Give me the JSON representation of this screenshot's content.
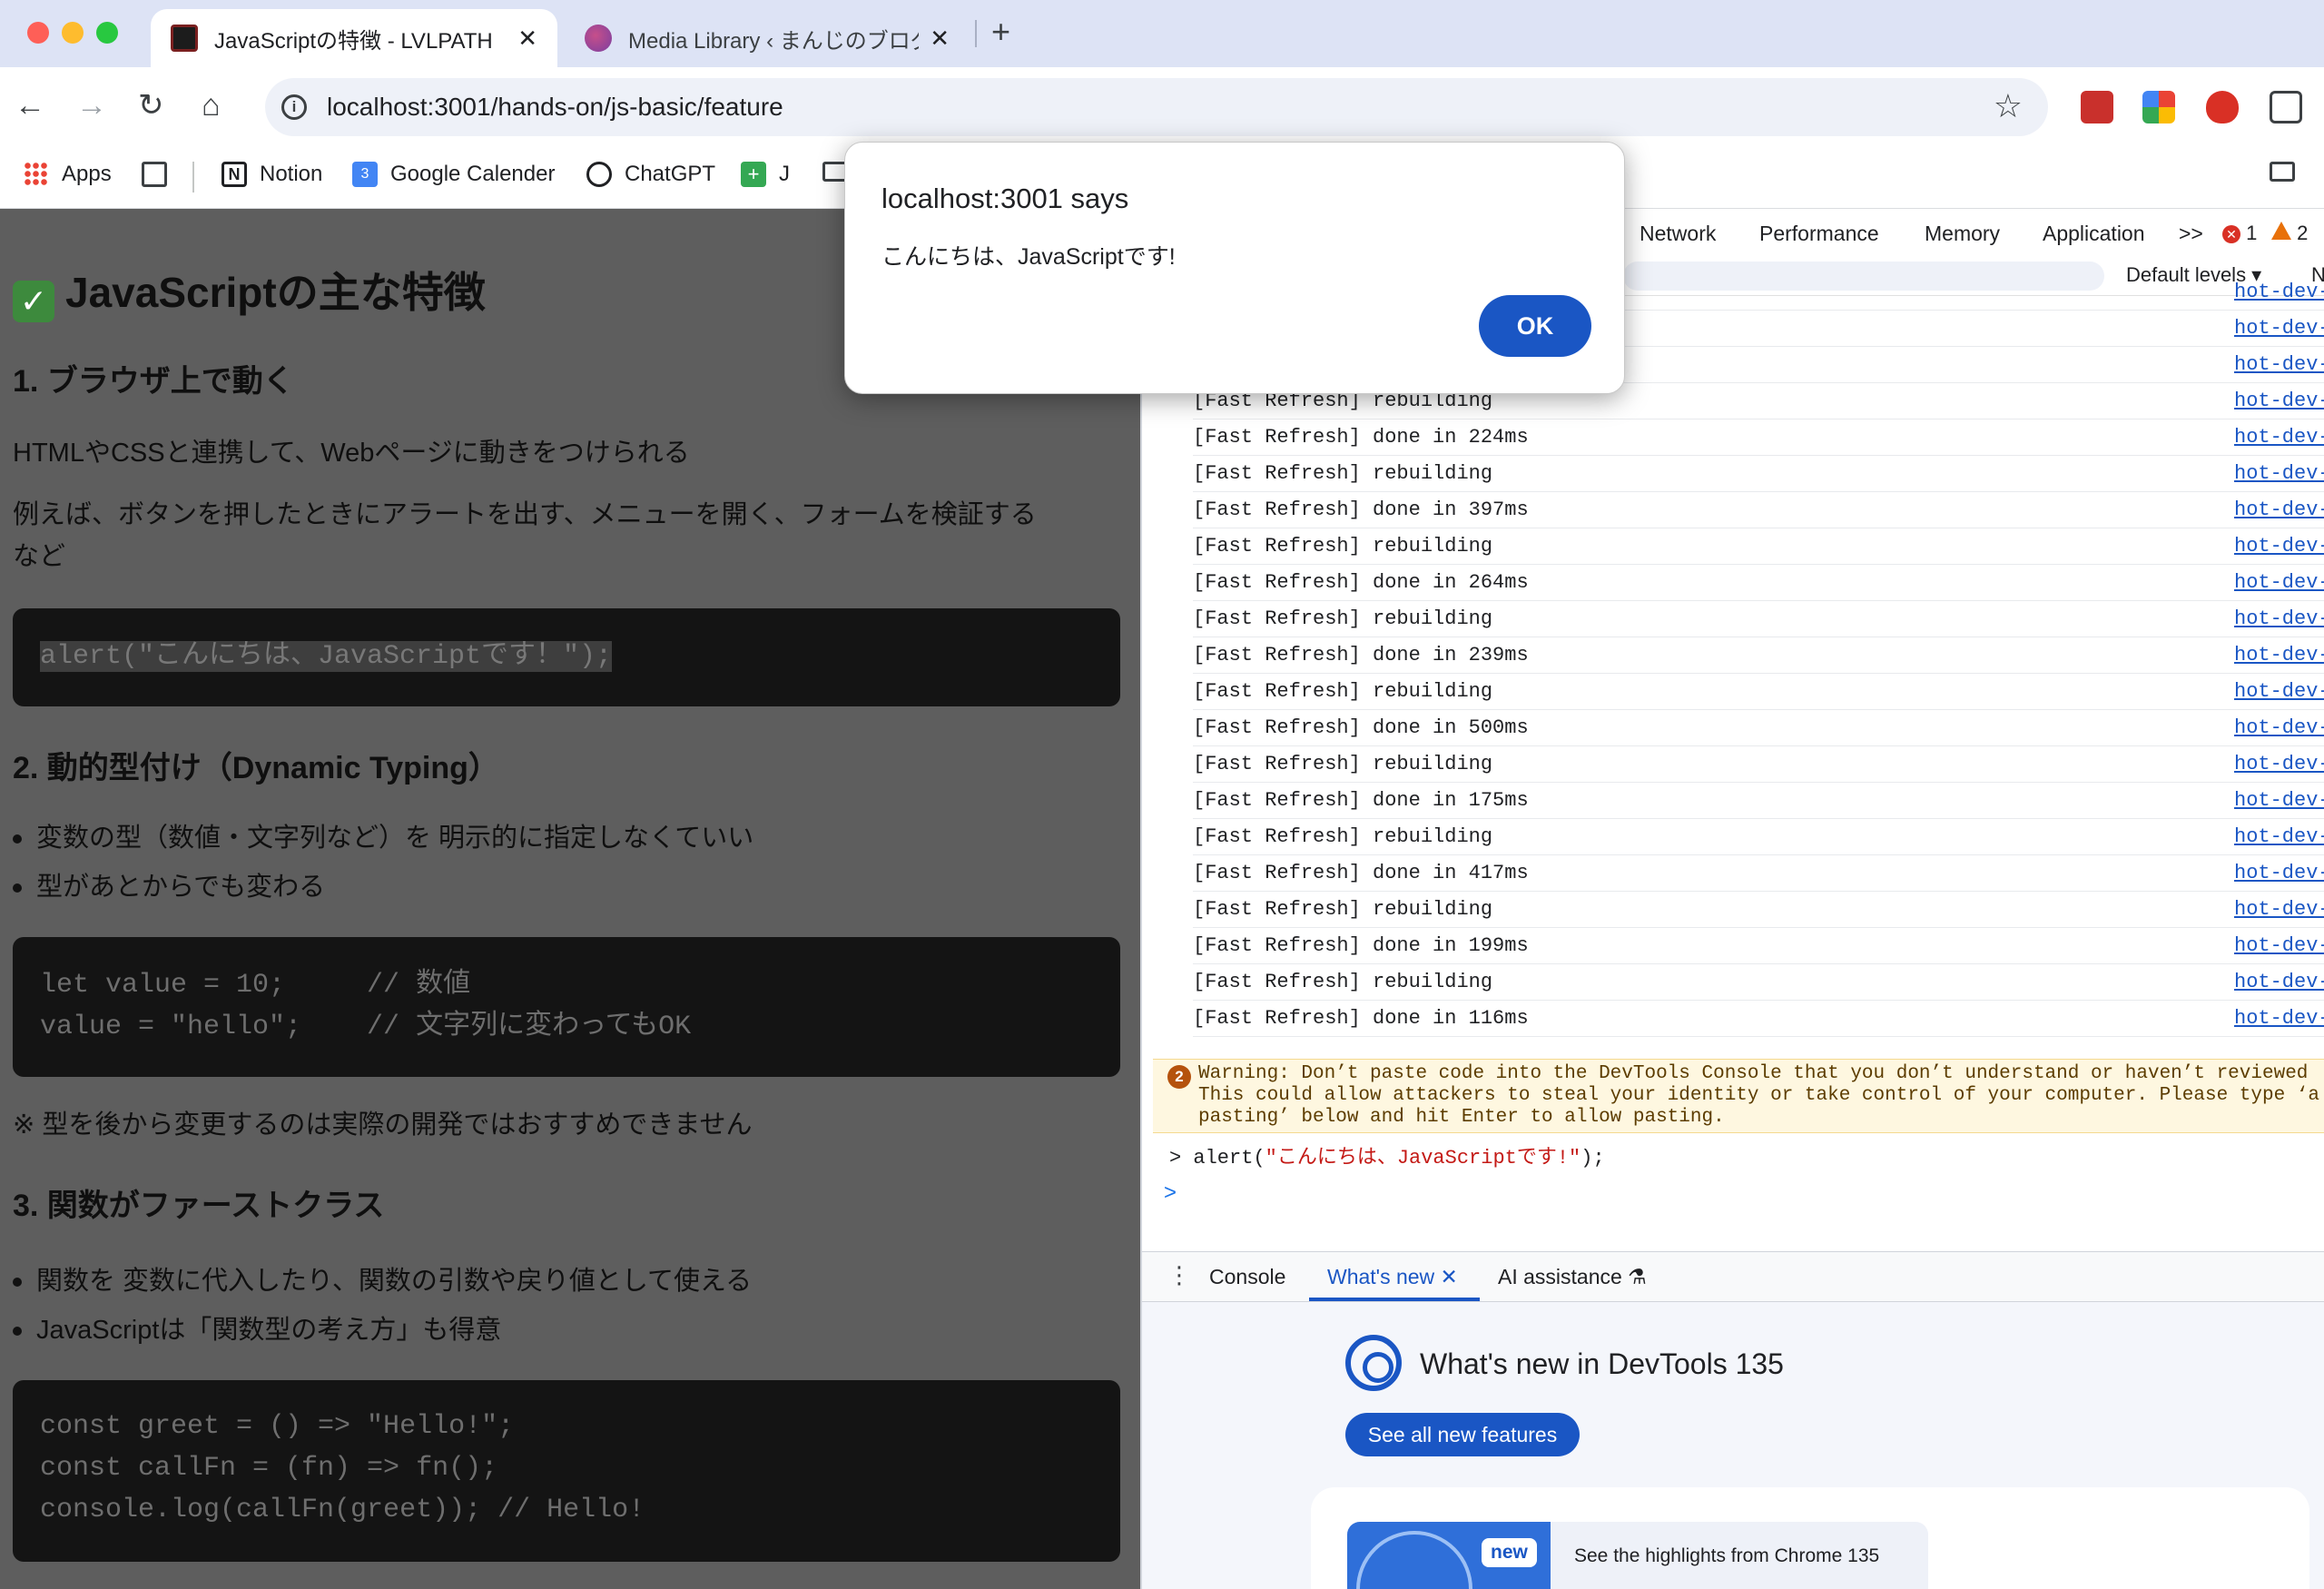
{
  "tabs": [
    {
      "title": "JavaScriptの特徴 - LVLPATH",
      "close": "✕"
    },
    {
      "title": "Media Library ‹ まんじのブログ",
      "close": "✕"
    }
  ],
  "new_tab_label": "+",
  "address_bar": {
    "url": "localhost:3001/hands-on/js-basic/feature",
    "info_icon": "i",
    "star": "☆"
  },
  "nav": {
    "back": "←",
    "forward": "→",
    "reload": "↻",
    "home": "⌂"
  },
  "bookmarks": [
    "Apps",
    "Notion",
    "Google Calender",
    "ChatGPT",
    "J"
  ],
  "bookmark_icons": {
    "notion": "N",
    "gcal": "3",
    "plus": "+"
  },
  "page": {
    "heading": "JavaScriptの主な特徴",
    "check": "✓",
    "section1": {
      "title": "1. ブラウザ上で動く",
      "p1": "HTMLやCSSと連携して、Webページに動きをつけられる",
      "p2a": "例えば、ボタンを押したときにアラートを出す、メニューを開く、フォームを検証する",
      "p2b": "など",
      "code": "alert(\"こんにちは、JavaScriptです！\");"
    },
    "section2": {
      "title": "2. 動的型付け（Dynamic Typing）",
      "bullets": [
        "変数の型（数値・文字列など）を 明示的に指定しなくていい",
        "型があとからでも変わる"
      ],
      "code": [
        "let value = 10;     // 数値",
        "value = \"hello\";    // 文字列に変わってもOK"
      ],
      "note": "※ 型を後から変更するのは実際の開発ではおすすめできません"
    },
    "section3": {
      "title": "3. 関数がファーストクラス",
      "bullets": [
        "関数を 変数に代入したり、関数の引数や戻り値として使える",
        "JavaScriptは「関数型の考え方」も得意"
      ],
      "code": [
        "const greet = () => \"Hello!\";",
        "const callFn = (fn) => fn();",
        "console.log(callFn(greet)); // Hello!"
      ]
    }
  },
  "devtools": {
    "tabs": [
      "Network",
      "Performance",
      "Memory",
      "Application",
      ">>"
    ],
    "errors": "1",
    "warnings": "2",
    "err_icon": "✕",
    "levels": "Default levels ▾",
    "right_cut": "N",
    "source": "hot-dev-clie",
    "logs": [
      "",
      "",
      "",
      "[Fast Refresh] rebuilding",
      "[Fast Refresh] done in 224ms",
      "[Fast Refresh] rebuilding",
      "[Fast Refresh] done in 397ms",
      "[Fast Refresh] rebuilding",
      "[Fast Refresh] done in 264ms",
      "[Fast Refresh] rebuilding",
      "[Fast Refresh] done in 239ms",
      "[Fast Refresh] rebuilding",
      "[Fast Refresh] done in 500ms",
      "[Fast Refresh] rebuilding",
      "[Fast Refresh] done in 175ms",
      "[Fast Refresh] rebuilding",
      "[Fast Refresh] done in 417ms",
      "[Fast Refresh] rebuilding",
      "[Fast Refresh] done in 199ms",
      "[Fast Refresh] rebuilding",
      "[Fast Refresh] done in 116ms"
    ],
    "warning": {
      "count": "2",
      "lines": [
        "Warning: Don’t paste code into the DevTools Console that you don’t understand or haven’t reviewed",
        "This could allow attackers to steal your identity or take control of your computer. Please type ‘a",
        "pasting’ below and hit Enter to allow pasting."
      ]
    },
    "input": {
      "caret": ">",
      "prefix": "alert(",
      "string": "\"こんにちは、JavaScriptです!\"",
      "suffix": ");"
    },
    "prompt": ">",
    "drawer": {
      "kebab": "⋮",
      "tabs": [
        "Console",
        "What's new ✕",
        "AI assistance ⚗"
      ]
    },
    "whats_new": {
      "title": "What's new in DevTools 135",
      "button": "See all new features",
      "badge": "new",
      "highlight": "See the highlights from Chrome 135"
    }
  },
  "alert": {
    "title": "localhost:3001 says",
    "message": "こんにちは、JavaScriptです!",
    "ok": "OK"
  }
}
